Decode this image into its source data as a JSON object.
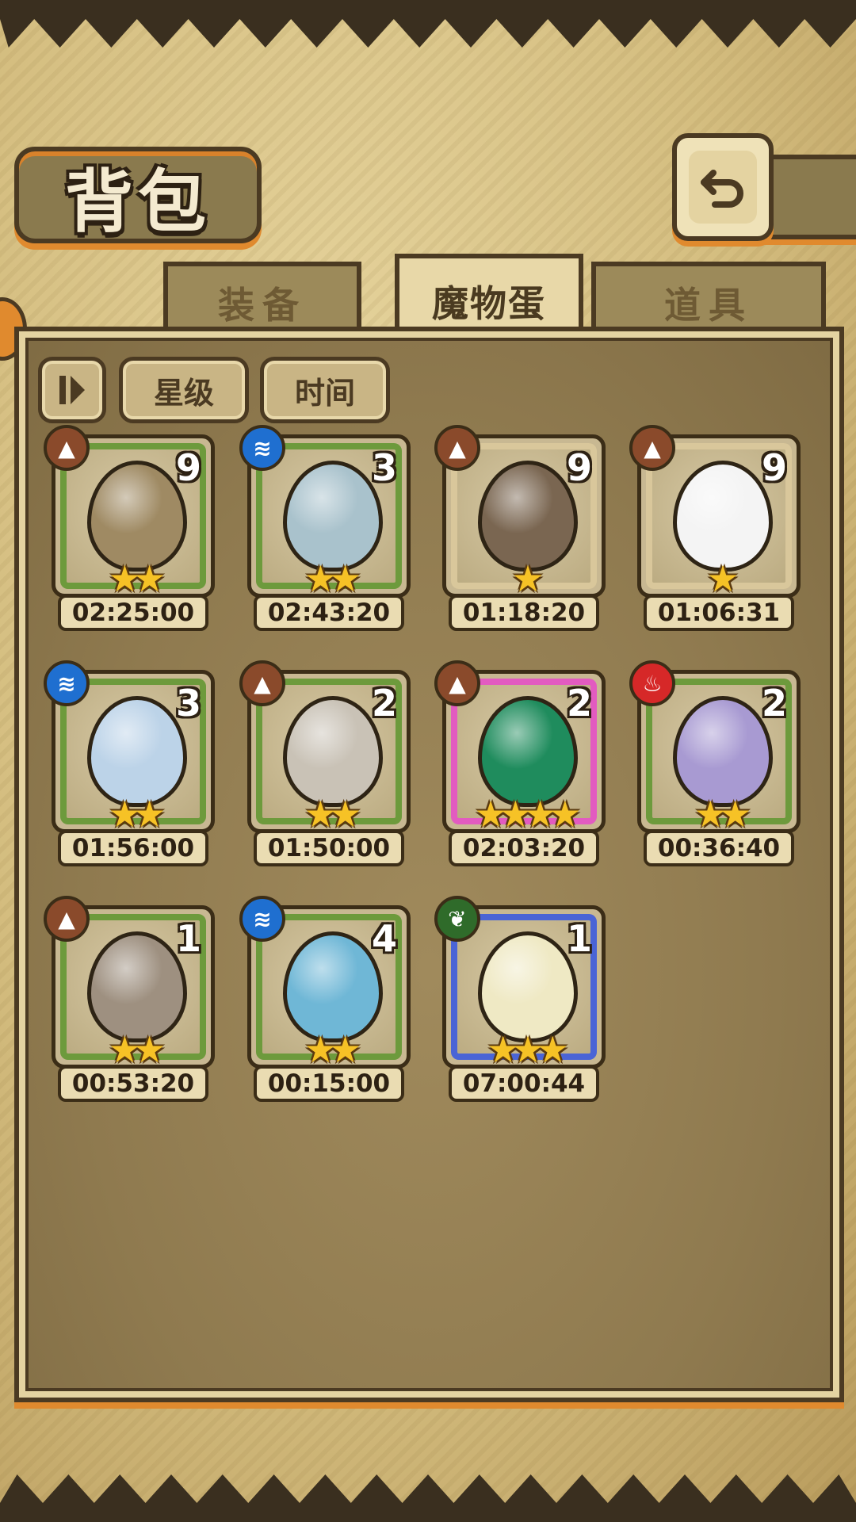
{
  "header": {
    "title": "背包"
  },
  "tabs": [
    {
      "label": "装备",
      "active": false
    },
    {
      "label": "魔物蛋",
      "active": true
    },
    {
      "label": "道具",
      "active": false
    }
  ],
  "sort": {
    "stars_label": "星级",
    "time_label": "时间"
  },
  "colors": {
    "earth": "#8a4a2b",
    "water": "#1f6fd0",
    "fire": "#d62828",
    "nature": "#2f6b2a",
    "star": "#f6c226",
    "accent_orange": "#e08a2e"
  },
  "eggs": [
    {
      "element": "earth-icon",
      "count": "9",
      "stars": "★★",
      "timer": "02:25:00",
      "frame": "green",
      "egg_color": "#9f8a63"
    },
    {
      "element": "water-icon",
      "count": "3",
      "stars": "★★",
      "timer": "02:43:20",
      "frame": "green",
      "egg_color": "#a9c2cc"
    },
    {
      "element": "earth-icon",
      "count": "9",
      "stars": "★",
      "timer": "01:18:20",
      "frame": "tan",
      "egg_color": "#7a6651"
    },
    {
      "element": "earth-icon",
      "count": "9",
      "stars": "★",
      "timer": "01:06:31",
      "frame": "tan",
      "egg_color": "#f4f4f4"
    },
    {
      "element": "water-icon",
      "count": "3",
      "stars": "★★",
      "timer": "01:56:00",
      "frame": "green",
      "egg_color": "#bcd3e8"
    },
    {
      "element": "earth-icon",
      "count": "2",
      "stars": "★★",
      "timer": "01:50:00",
      "frame": "green",
      "egg_color": "#c9c2b6"
    },
    {
      "element": "earth-icon",
      "count": "2",
      "stars": "★★★★",
      "timer": "02:03:20",
      "frame": "pink",
      "egg_color": "#1f8c5d"
    },
    {
      "element": "fire-icon",
      "count": "2",
      "stars": "★★",
      "timer": "00:36:40",
      "frame": "green",
      "egg_color": "#a89ad2"
    },
    {
      "element": "earth-icon",
      "count": "1",
      "stars": "★★",
      "timer": "00:53:20",
      "frame": "green",
      "egg_color": "#9e9080"
    },
    {
      "element": "water-icon",
      "count": "4",
      "stars": "★★",
      "timer": "00:15:00",
      "frame": "green",
      "egg_color": "#6fb7d6"
    },
    {
      "element": "nature-icon",
      "count": "1",
      "stars": "★★★",
      "timer": "07:00:44",
      "frame": "blue",
      "egg_color": "#efe9c4"
    }
  ]
}
